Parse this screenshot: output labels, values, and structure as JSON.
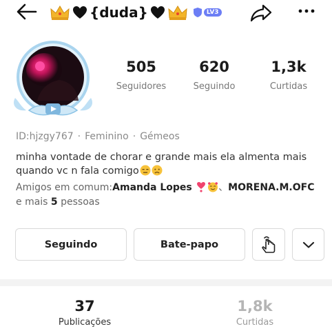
{
  "header": {
    "title_name": "{duda}",
    "level_badge": "LV3"
  },
  "stats": [
    {
      "value": "505",
      "label": "Seguidores"
    },
    {
      "value": "620",
      "label": "Seguindo"
    },
    {
      "value": "1,3k",
      "label": "Curtidas"
    }
  ],
  "meta": {
    "id": "ID:hjzgy767",
    "gender": "Feminino",
    "sign": "Gémeos",
    "separator": "·"
  },
  "bio": {
    "line1": "minha vontade de chorar e grande mais ela almenta mais",
    "line2": "quando vc n fala comigo"
  },
  "friends": {
    "prefix": "Amigos em comum:",
    "friend1": "Amanda Lopes",
    "sep": "、",
    "friend2": "MORENA.M.OFC",
    "more_prefix": "e mais ",
    "more_count": "5",
    "more_suffix": " pessoas"
  },
  "actions": {
    "following_label": "Seguindo",
    "chat_label": "Bate-papo"
  },
  "tabs": [
    {
      "value": "37",
      "label": "Publicações"
    },
    {
      "value": "1,8k",
      "label": "Curtidas"
    }
  ],
  "colors": {
    "level_badge": "#6c7ef5",
    "avatar_ring": "#a9d4ee",
    "crown": "#f3b52a",
    "heart": "#111111",
    "muted_text": "#8a8a8a"
  }
}
